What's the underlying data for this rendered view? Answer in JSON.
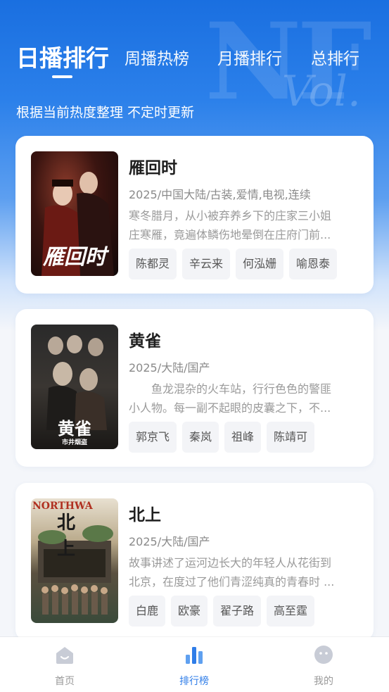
{
  "tabs": [
    {
      "label": "日播排行",
      "active": true
    },
    {
      "label": "周播热榜",
      "active": false
    },
    {
      "label": "月播排行",
      "active": false
    },
    {
      "label": "总排行",
      "active": false
    }
  ],
  "subtitle": "根据当前热度整理 不定时更新",
  "cards": [
    {
      "title": "雁回时",
      "meta": "2025/中国大陆/古装,爱情,电视,连续",
      "desc_lines": [
        "寒冬腊月，从小被弃养乡下的庄家三小姐",
        "庄寒雁，竟遍体鳞伤地晕倒在庄府门前..."
      ],
      "poster_text": "雁回时",
      "cast": [
        "陈都灵",
        "辛云来",
        "何泓姗",
        "喻恩泰"
      ]
    },
    {
      "title": "黄雀",
      "meta": "2025/大陆/国产",
      "desc_lines": [
        "　　鱼龙混杂的火车站，行行色色的警匪",
        "小人物。每一副不起眼的皮囊之下，不..."
      ],
      "poster_text": "黄雀",
      "poster_sub": "市井烟盗",
      "cast": [
        "郭京飞",
        "秦岚",
        "祖峰",
        "陈靖可"
      ]
    },
    {
      "title": "北上",
      "meta": "2025/大陆/国产",
      "desc_lines": [
        "故事讲述了运河边长大的年轻人从花街到",
        "北京，在度过了他们青涩纯真的青春时 ..."
      ],
      "poster_text": "北上",
      "poster_en": "NORTHWA",
      "cast": [
        "白鹿",
        "欧豪",
        "翟子路",
        "高至霆"
      ]
    }
  ],
  "bottom_nav": [
    {
      "label": "首页",
      "icon": "home-icon",
      "active": false
    },
    {
      "label": "排行榜",
      "icon": "chart-icon",
      "active": true
    },
    {
      "label": "我的",
      "icon": "profile-icon",
      "active": false
    }
  ],
  "colors": {
    "primary": "#2f7de8",
    "hero_top": "#1a6fe0"
  }
}
